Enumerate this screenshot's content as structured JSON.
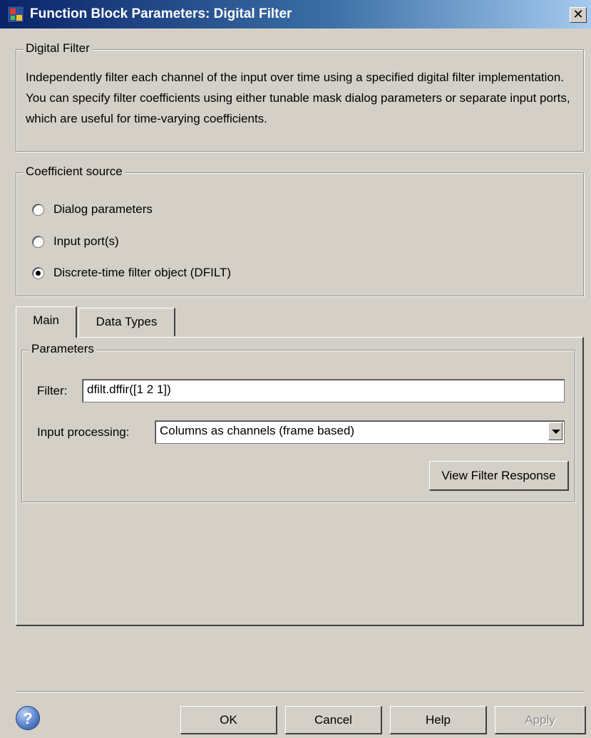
{
  "window": {
    "title": "Function Block Parameters: Digital Filter",
    "close_glyph": "✕"
  },
  "description_group": {
    "legend": "Digital Filter",
    "text": "Independently filter each channel of the input over time using a specified digital filter implementation. You can specify filter coefficients using either tunable mask dialog parameters or separate input ports, which are useful for time-varying coefficients."
  },
  "coefficient_source": {
    "legend": "Coefficient source",
    "options": [
      {
        "label": "Dialog parameters",
        "selected": false
      },
      {
        "label": "Input port(s)",
        "selected": false
      },
      {
        "label": "Discrete-time filter object (DFILT)",
        "selected": true
      }
    ]
  },
  "tabs": [
    {
      "label": "Main",
      "active": true
    },
    {
      "label": "Data Types",
      "active": false
    }
  ],
  "parameters": {
    "legend": "Parameters",
    "filter_label": "Filter:",
    "filter_value": "dfilt.dffir([1 2 1])",
    "input_processing_label": "Input processing:",
    "input_processing_value": "Columns as channels (frame based)",
    "view_filter_response_label": "View Filter Response"
  },
  "footer": {
    "help_icon_glyph": "?",
    "ok_label": "OK",
    "cancel_label": "Cancel",
    "help_label": "Help",
    "apply_label": "Apply"
  },
  "colors": {
    "dialog_background": "#d4d0c8",
    "titlebar_start": "#0a246a",
    "titlebar_end": "#a6caf0"
  }
}
